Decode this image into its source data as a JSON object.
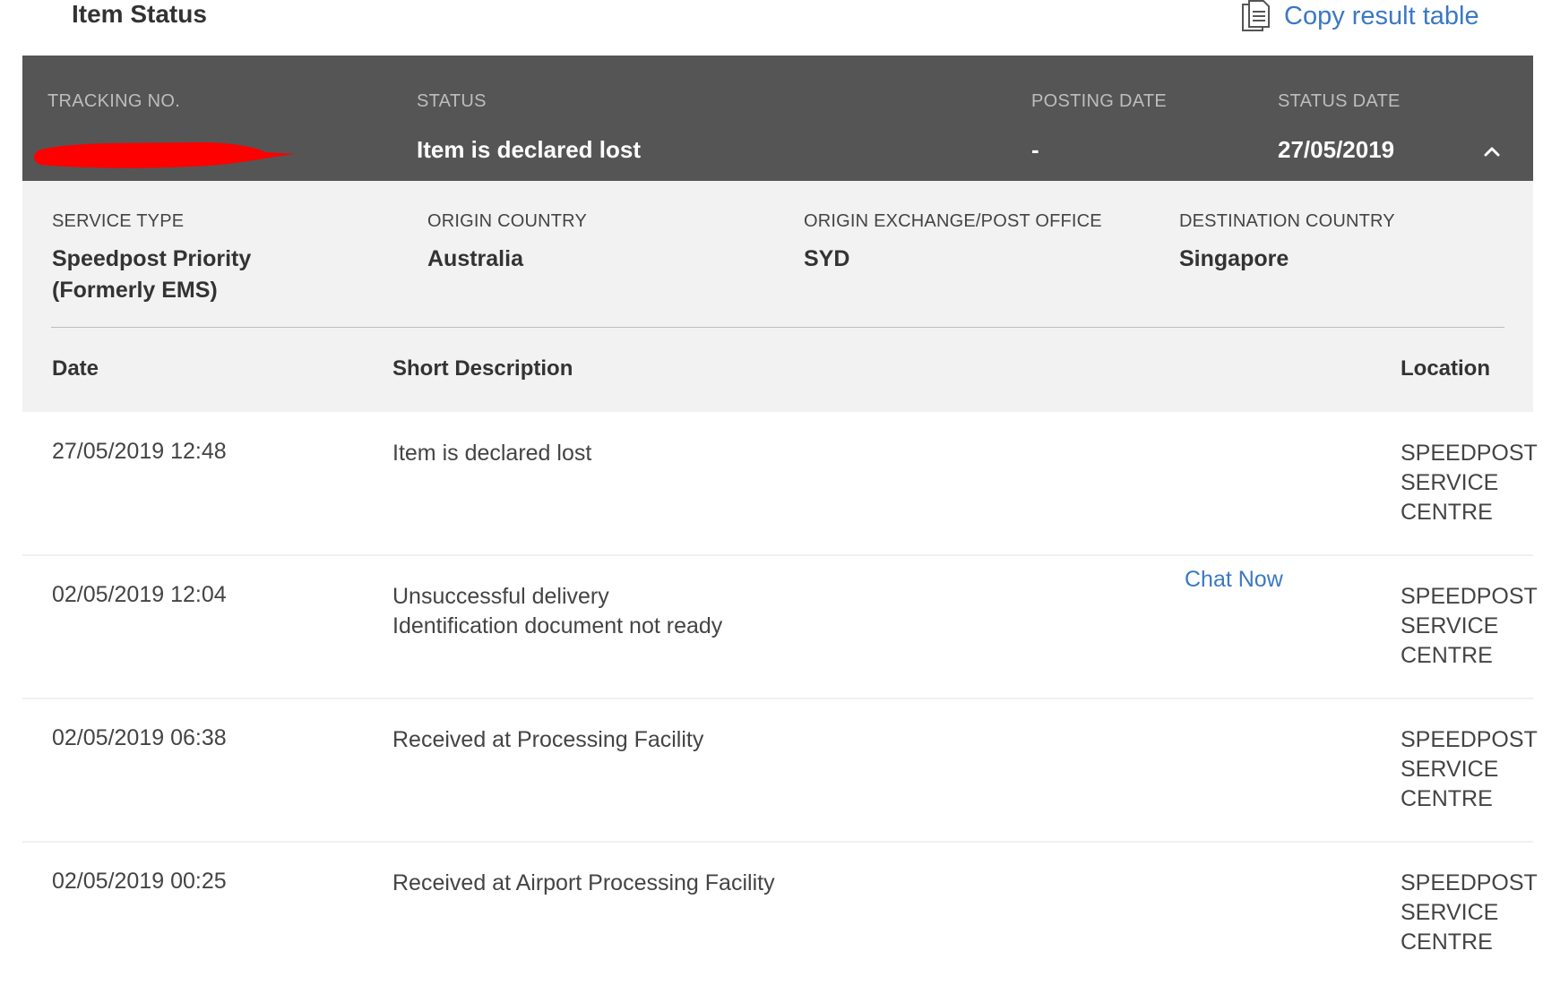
{
  "header": {
    "title": "Item Status",
    "copy_label": "Copy result table",
    "copy_icon": "document-copy-icon"
  },
  "summary": {
    "labels": {
      "tracking": "TRACKING NO.",
      "status": "STATUS",
      "posting_date": "POSTING DATE",
      "status_date": "STATUS DATE"
    },
    "status": "Item is declared lost",
    "posting_date": "-",
    "status_date": "27/05/2019",
    "redaction_color": "#ff0000",
    "collapse_icon": "chevron-up-icon"
  },
  "details": {
    "service_type_label": "SERVICE TYPE",
    "service_type_line1": "Speedpost Priority",
    "service_type_line2": "(Formerly EMS)",
    "origin_country_label": "ORIGIN COUNTRY",
    "origin_country": "Australia",
    "origin_office_label": "ORIGIN EXCHANGE/POST OFFICE",
    "origin_office": "SYD",
    "destination_country_label": "DESTINATION COUNTRY",
    "destination_country": "Singapore"
  },
  "table": {
    "headers": {
      "date": "Date",
      "description": "Short Description",
      "location": "Location"
    },
    "rows": [
      {
        "date": "27/05/2019 12:48",
        "desc_line1": "Item is declared lost",
        "desc_line2": "",
        "loc": [
          "SPEEDPOST",
          "SERVICE",
          "CENTRE"
        ]
      },
      {
        "date": "02/05/2019 12:04",
        "desc_line1": "Unsuccessful delivery",
        "desc_line2": "Identification document not ready",
        "loc": [
          "SPEEDPOST",
          "SERVICE",
          "CENTRE"
        ]
      },
      {
        "date": "02/05/2019 06:38",
        "desc_line1": "Received at Processing Facility",
        "desc_line2": "",
        "loc": [
          "SPEEDPOST",
          "SERVICE",
          "CENTRE"
        ]
      },
      {
        "date": "02/05/2019 00:25",
        "desc_line1": "Received at Airport Processing Facility",
        "desc_line2": "",
        "loc": [
          "SPEEDPOST",
          "SERVICE",
          "CENTRE"
        ]
      }
    ]
  },
  "chat": {
    "label": "Chat Now"
  },
  "colors": {
    "header_bg": "#555555",
    "details_bg": "#f2f2f2",
    "link": "#3b78c4"
  }
}
